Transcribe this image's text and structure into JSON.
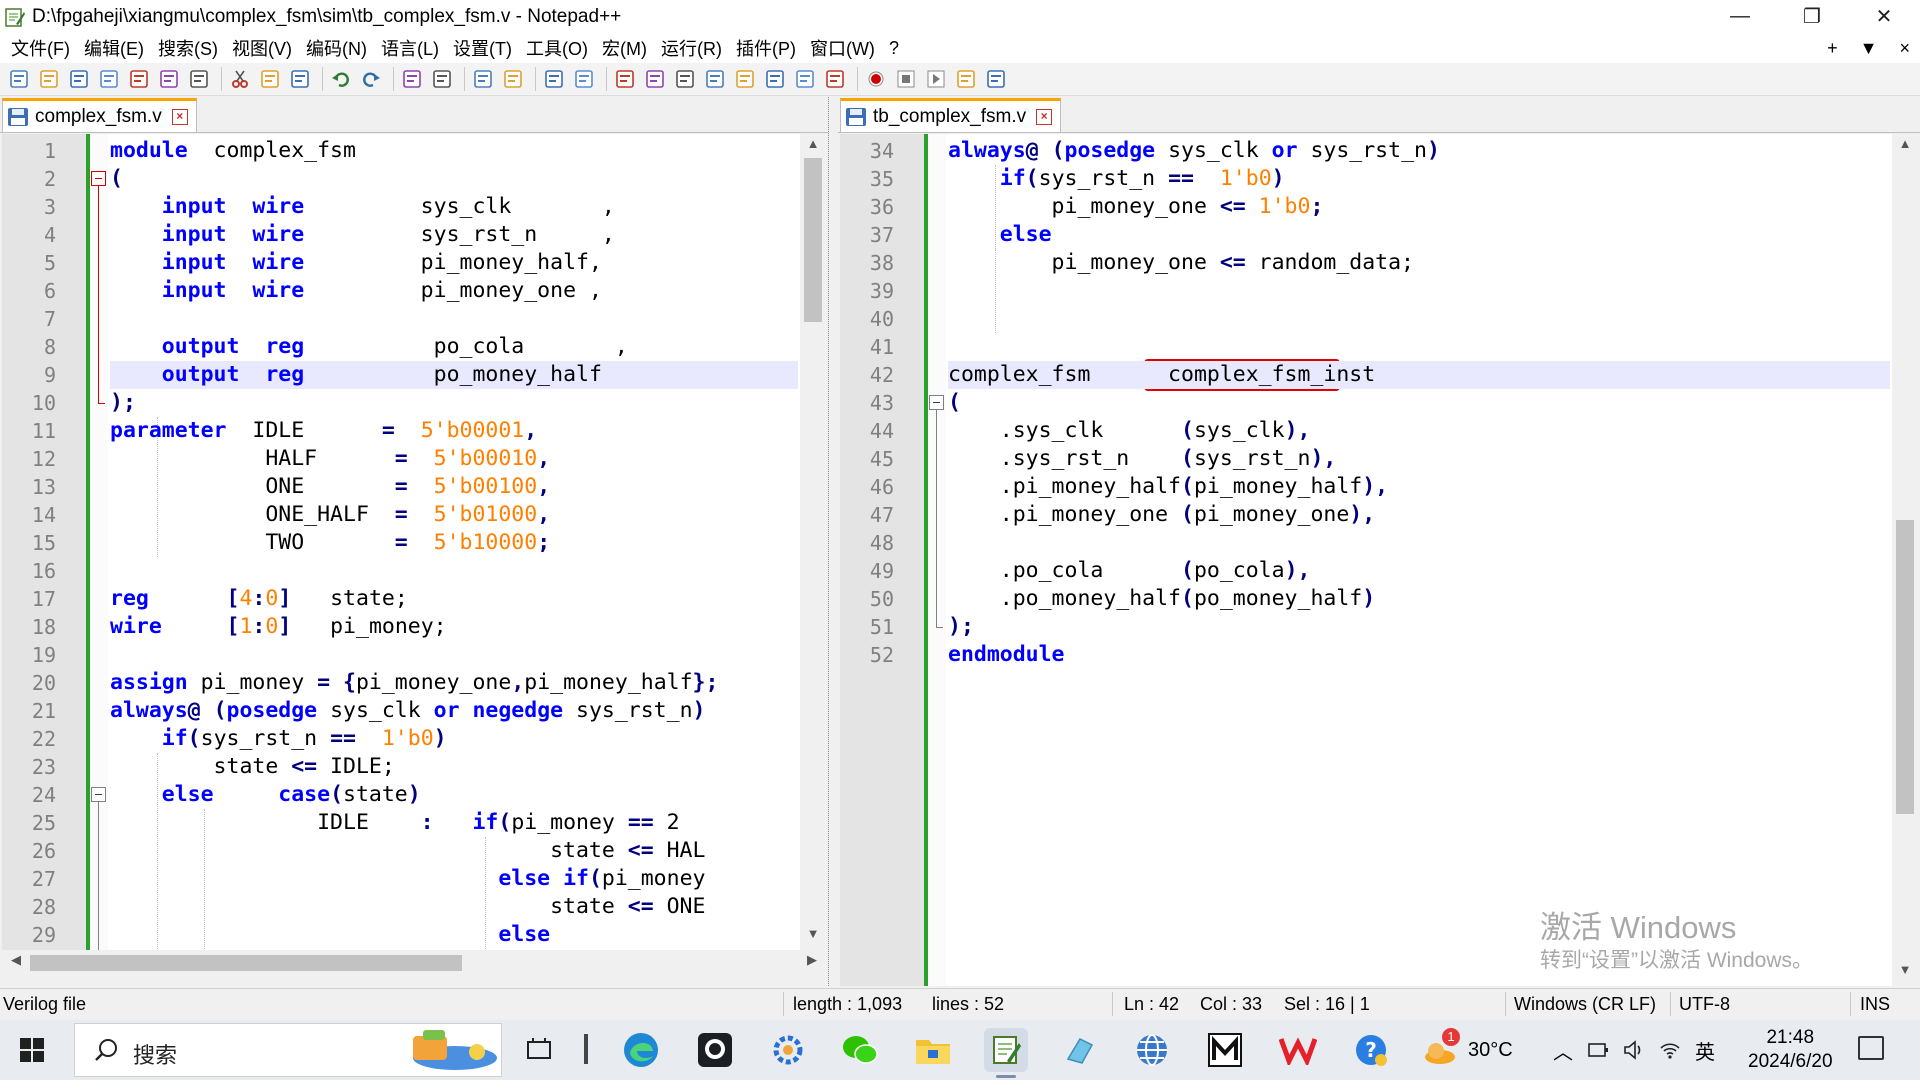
{
  "window": {
    "title": "D:\\fpgaheji\\xiangmu\\complex_fsm\\sim\\tb_complex_fsm.v - Notepad++",
    "minimize_glyph": "—",
    "restore_glyph": "❐",
    "close_glyph": "✕"
  },
  "menu": {
    "items": [
      "文件(F)",
      "编辑(E)",
      "搜索(S)",
      "视图(V)",
      "编码(N)",
      "语言(L)",
      "设置(T)",
      "工具(O)",
      "宏(M)",
      "运行(R)",
      "插件(P)",
      "窗口(W)",
      "?"
    ],
    "right": [
      "+",
      "▼",
      "×"
    ]
  },
  "toolbar": {
    "icons": [
      "new-file-icon",
      "open-file-icon",
      "save-icon",
      "save-all-icon",
      "close-icon",
      "close-all-icon",
      "print-icon",
      "cut-icon",
      "copy-icon",
      "paste-icon",
      "undo-icon",
      "redo-icon",
      "find-icon",
      "replace-icon",
      "zoom-in-icon",
      "zoom-out-icon",
      "sync-v-icon",
      "sync-h-icon",
      "word-wrap-icon",
      "show-all-chars-icon",
      "indent-guide-icon",
      "doc-map-icon",
      "function-list-icon",
      "folder-workspace-icon",
      "monitor-icon",
      "eye-icon",
      "record-macro-icon",
      "stop-macro-icon",
      "play-macro-icon",
      "run-macro-multiple-icon",
      "save-macro-icon"
    ]
  },
  "left_pane": {
    "tab_label": "complex_fsm.v",
    "tab_close": "×",
    "highlighted_line": 9,
    "lines": [
      {
        "n": "1",
        "t": [
          [
            "kw",
            "module"
          ],
          [
            "",
            "  complex_fsm"
          ]
        ]
      },
      {
        "n": "2",
        "t": [
          [
            "op",
            "("
          ]
        ]
      },
      {
        "n": "3",
        "t": [
          [
            "",
            "    "
          ],
          [
            "kw",
            "input"
          ],
          [
            "",
            "  "
          ],
          [
            "kw",
            "wire"
          ],
          [
            "",
            "         sys_clk       ,"
          ]
        ]
      },
      {
        "n": "4",
        "t": [
          [
            "",
            "    "
          ],
          [
            "kw",
            "input"
          ],
          [
            "",
            "  "
          ],
          [
            "kw",
            "wire"
          ],
          [
            "",
            "         sys_rst_n     ,"
          ]
        ]
      },
      {
        "n": "5",
        "t": [
          [
            "",
            "    "
          ],
          [
            "kw",
            "input"
          ],
          [
            "",
            "  "
          ],
          [
            "kw",
            "wire"
          ],
          [
            "",
            "         pi_money_half,"
          ]
        ]
      },
      {
        "n": "6",
        "t": [
          [
            "",
            "    "
          ],
          [
            "kw",
            "input"
          ],
          [
            "",
            "  "
          ],
          [
            "kw",
            "wire"
          ],
          [
            "",
            "         pi_money_one ,"
          ]
        ]
      },
      {
        "n": "7",
        "t": []
      },
      {
        "n": "8",
        "t": [
          [
            "",
            "    "
          ],
          [
            "kw",
            "output"
          ],
          [
            "",
            "  "
          ],
          [
            "kw",
            "reg"
          ],
          [
            "",
            "          po_cola       ,"
          ]
        ]
      },
      {
        "n": "9",
        "t": [
          [
            "",
            "    "
          ],
          [
            "kw",
            "output"
          ],
          [
            "",
            "  "
          ],
          [
            "kw",
            "reg"
          ],
          [
            "",
            "          po_money_half"
          ]
        ]
      },
      {
        "n": "10",
        "t": [
          [
            "op",
            ");"
          ]
        ]
      },
      {
        "n": "11",
        "t": [
          [
            "kw",
            "parameter"
          ],
          [
            "",
            "  IDLE      "
          ],
          [
            "op",
            "="
          ],
          [
            "",
            "  "
          ],
          [
            "num",
            "5'b00001"
          ],
          [
            "op",
            ","
          ]
        ]
      },
      {
        "n": "12",
        "t": [
          [
            "",
            "            HALF      "
          ],
          [
            "op",
            "="
          ],
          [
            "",
            "  "
          ],
          [
            "num",
            "5'b00010"
          ],
          [
            "op",
            ","
          ]
        ]
      },
      {
        "n": "13",
        "t": [
          [
            "",
            "            ONE       "
          ],
          [
            "op",
            "="
          ],
          [
            "",
            "  "
          ],
          [
            "num",
            "5'b00100"
          ],
          [
            "op",
            ","
          ]
        ]
      },
      {
        "n": "14",
        "t": [
          [
            "",
            "            ONE_HALF  "
          ],
          [
            "op",
            "="
          ],
          [
            "",
            "  "
          ],
          [
            "num",
            "5'b01000"
          ],
          [
            "op",
            ","
          ]
        ]
      },
      {
        "n": "15",
        "t": [
          [
            "",
            "            TWO       "
          ],
          [
            "op",
            "="
          ],
          [
            "",
            "  "
          ],
          [
            "num",
            "5'b10000"
          ],
          [
            "op",
            ";"
          ]
        ]
      },
      {
        "n": "16",
        "t": []
      },
      {
        "n": "17",
        "t": [
          [
            "kw",
            "reg"
          ],
          [
            "",
            "      "
          ],
          [
            "op",
            "["
          ],
          [
            "num",
            "4"
          ],
          [
            "op",
            ":"
          ],
          [
            "num",
            "0"
          ],
          [
            "op",
            "]"
          ],
          [
            "",
            "   state;"
          ]
        ]
      },
      {
        "n": "18",
        "t": [
          [
            "kw",
            "wire"
          ],
          [
            "",
            "     "
          ],
          [
            "op",
            "["
          ],
          [
            "num",
            "1"
          ],
          [
            "op",
            ":"
          ],
          [
            "num",
            "0"
          ],
          [
            "op",
            "]"
          ],
          [
            "",
            "   pi_money;"
          ]
        ]
      },
      {
        "n": "19",
        "t": []
      },
      {
        "n": "20",
        "t": [
          [
            "kw",
            "assign"
          ],
          [
            "",
            " pi_money "
          ],
          [
            "op",
            "="
          ],
          [
            "",
            ""
          ],
          [
            "op",
            " {"
          ],
          [
            "",
            "pi_money_one"
          ],
          [
            "op",
            ","
          ],
          [
            "",
            "pi_money_half"
          ],
          [
            "op",
            "};"
          ]
        ]
      },
      {
        "n": "21",
        "t": [
          [
            "kw",
            "always"
          ],
          [
            "op",
            "@"
          ],
          [
            "op",
            " ("
          ],
          [
            "kw",
            "posedge"
          ],
          [
            "",
            " sys_clk "
          ],
          [
            "kw",
            "or"
          ],
          [
            "",
            " "
          ],
          [
            "kw",
            "negedge"
          ],
          [
            "",
            " sys_rst_n"
          ],
          [
            "op",
            ")"
          ]
        ]
      },
      {
        "n": "22",
        "t": [
          [
            "",
            "    "
          ],
          [
            "kw",
            "if"
          ],
          [
            "op",
            "("
          ],
          [
            "",
            "sys_rst_n "
          ],
          [
            "op",
            "=="
          ],
          [
            "",
            "  "
          ],
          [
            "num",
            "1'b0"
          ],
          [
            "op",
            ")"
          ]
        ]
      },
      {
        "n": "23",
        "t": [
          [
            "",
            "        state "
          ],
          [
            "op",
            "<="
          ],
          [
            "",
            ""
          ],
          [
            "",
            ""
          ],
          [
            "",
            " IDLE;"
          ]
        ]
      },
      {
        "n": "24",
        "t": [
          [
            "",
            "    "
          ],
          [
            "kw",
            "else"
          ],
          [
            "",
            "     "
          ],
          [
            "kw",
            "case"
          ],
          [
            "op",
            "("
          ],
          [
            "",
            "state"
          ],
          [
            "op",
            ")"
          ]
        ]
      },
      {
        "n": "25",
        "t": [
          [
            "",
            "                IDLE    "
          ],
          [
            "op",
            ":"
          ],
          [
            "",
            "   "
          ],
          [
            "kw",
            "if"
          ],
          [
            "op",
            "("
          ],
          [
            "",
            "pi_money "
          ],
          [
            "op",
            "=="
          ],
          [
            "",
            " 2"
          ]
        ]
      },
      {
        "n": "26",
        "t": [
          [
            "",
            "                                  state "
          ],
          [
            "op",
            "<="
          ],
          [
            "",
            " HAL"
          ]
        ]
      },
      {
        "n": "27",
        "t": [
          [
            "",
            "                              "
          ],
          [
            "kw",
            "else"
          ],
          [
            "",
            " "
          ],
          [
            "kw",
            "if"
          ],
          [
            "op",
            "("
          ],
          [
            "",
            "pi_money"
          ]
        ]
      },
      {
        "n": "28",
        "t": [
          [
            "",
            "                                  state "
          ],
          [
            "op",
            "<="
          ],
          [
            "",
            " ONE"
          ]
        ]
      },
      {
        "n": "29",
        "t": [
          [
            "",
            "                              "
          ],
          [
            "kw",
            "else"
          ]
        ]
      }
    ]
  },
  "right_pane": {
    "tab_label": "tb_complex_fsm.v",
    "tab_close": "×",
    "highlighted_line": 42,
    "lines": [
      {
        "n": "34",
        "t": [
          [
            "kw",
            "always"
          ],
          [
            "op",
            "@"
          ],
          [
            "op",
            " ("
          ],
          [
            "kw",
            "posedge"
          ],
          [
            "",
            " sys_clk "
          ],
          [
            "kw",
            "or"
          ],
          [
            "",
            " sys_rst_n"
          ],
          [
            "op",
            ")"
          ]
        ]
      },
      {
        "n": "35",
        "t": [
          [
            "",
            "    "
          ],
          [
            "kw",
            "if"
          ],
          [
            "op",
            "("
          ],
          [
            "",
            "sys_rst_n "
          ],
          [
            "op",
            "=="
          ],
          [
            "",
            "  "
          ],
          [
            "num",
            "1'b0"
          ],
          [
            "op",
            ")"
          ]
        ]
      },
      {
        "n": "36",
        "t": [
          [
            "",
            "        pi_money_one "
          ],
          [
            "op",
            "<="
          ],
          [
            "",
            " "
          ],
          [
            "num",
            "1'b0"
          ],
          [
            "op",
            ";"
          ]
        ]
      },
      {
        "n": "37",
        "t": [
          [
            "",
            "    "
          ],
          [
            "kw",
            "else"
          ]
        ]
      },
      {
        "n": "38",
        "t": [
          [
            "",
            "        pi_money_one "
          ],
          [
            "op",
            "<="
          ],
          [
            "",
            " random_data;"
          ]
        ]
      },
      {
        "n": "39",
        "t": []
      },
      {
        "n": "40",
        "t": []
      },
      {
        "n": "41",
        "t": []
      },
      {
        "n": "42",
        "t": [
          [
            "",
            "complex_fsm      complex_fsm_inst"
          ]
        ]
      },
      {
        "n": "43",
        "t": [
          [
            "op",
            "("
          ]
        ]
      },
      {
        "n": "44",
        "t": [
          [
            "",
            "    .sys_clk      "
          ],
          [
            "op",
            "("
          ],
          [
            "",
            "sys_clk"
          ],
          [
            "op",
            "),"
          ]
        ]
      },
      {
        "n": "45",
        "t": [
          [
            "",
            "    .sys_rst_n    "
          ],
          [
            "op",
            "("
          ],
          [
            "",
            "sys_rst_n"
          ],
          [
            "op",
            "),"
          ]
        ]
      },
      {
        "n": "46",
        "t": [
          [
            "",
            "    .pi_money_half"
          ],
          [
            "op",
            "("
          ],
          [
            "",
            "pi_money_half"
          ],
          [
            "op",
            "),"
          ]
        ]
      },
      {
        "n": "47",
        "t": [
          [
            "",
            "    .pi_money_one "
          ],
          [
            "op",
            "("
          ],
          [
            "",
            "pi_money_one"
          ],
          [
            "op",
            "),"
          ]
        ]
      },
      {
        "n": "48",
        "t": []
      },
      {
        "n": "49",
        "t": [
          [
            "",
            "    .po_cola      "
          ],
          [
            "op",
            "("
          ],
          [
            "",
            "po_cola"
          ],
          [
            "op",
            "),"
          ]
        ]
      },
      {
        "n": "50",
        "t": [
          [
            "",
            "    .po_money_half"
          ],
          [
            "op",
            "("
          ],
          [
            "",
            "po_money_half"
          ],
          [
            "op",
            ")"
          ]
        ]
      },
      {
        "n": "51",
        "t": [
          [
            "op",
            ");"
          ]
        ]
      },
      {
        "n": "52",
        "t": [
          [
            "kw",
            "endmodule"
          ]
        ]
      }
    ]
  },
  "watermark": {
    "line1": "激活 Windows",
    "line2": "转到“设置”以激活 Windows。"
  },
  "status": {
    "file_type": "Verilog file",
    "length": "length : 1,093",
    "lines": "lines : 52",
    "ln": "Ln : 42",
    "col": "Col : 33",
    "sel": "Sel : 16 | 1",
    "eol": "Windows (CR LF)",
    "encoding": "UTF-8",
    "mode": "INS"
  },
  "taskbar": {
    "search_placeholder": "搜索",
    "apps": [
      "task-view-icon",
      "edge-icon",
      "github-icon",
      "settings-gear-icon",
      "wechat-icon",
      "file-explorer-icon",
      "notepadpp-icon",
      "eraser-icon",
      "network-globe-icon",
      "modelsim-icon",
      "wps-icon",
      "help-icon"
    ],
    "weather_badge": "1",
    "temperature": "30°C",
    "ime": "英",
    "time": "21:48",
    "date": "2024/6/20"
  },
  "colors": {
    "keyword": "#0000ff",
    "number": "#ff8000",
    "operator": "#000080",
    "change_bar": "#2ca02c",
    "highlight": "#4cc54c",
    "annotation_box": "#e00000"
  }
}
